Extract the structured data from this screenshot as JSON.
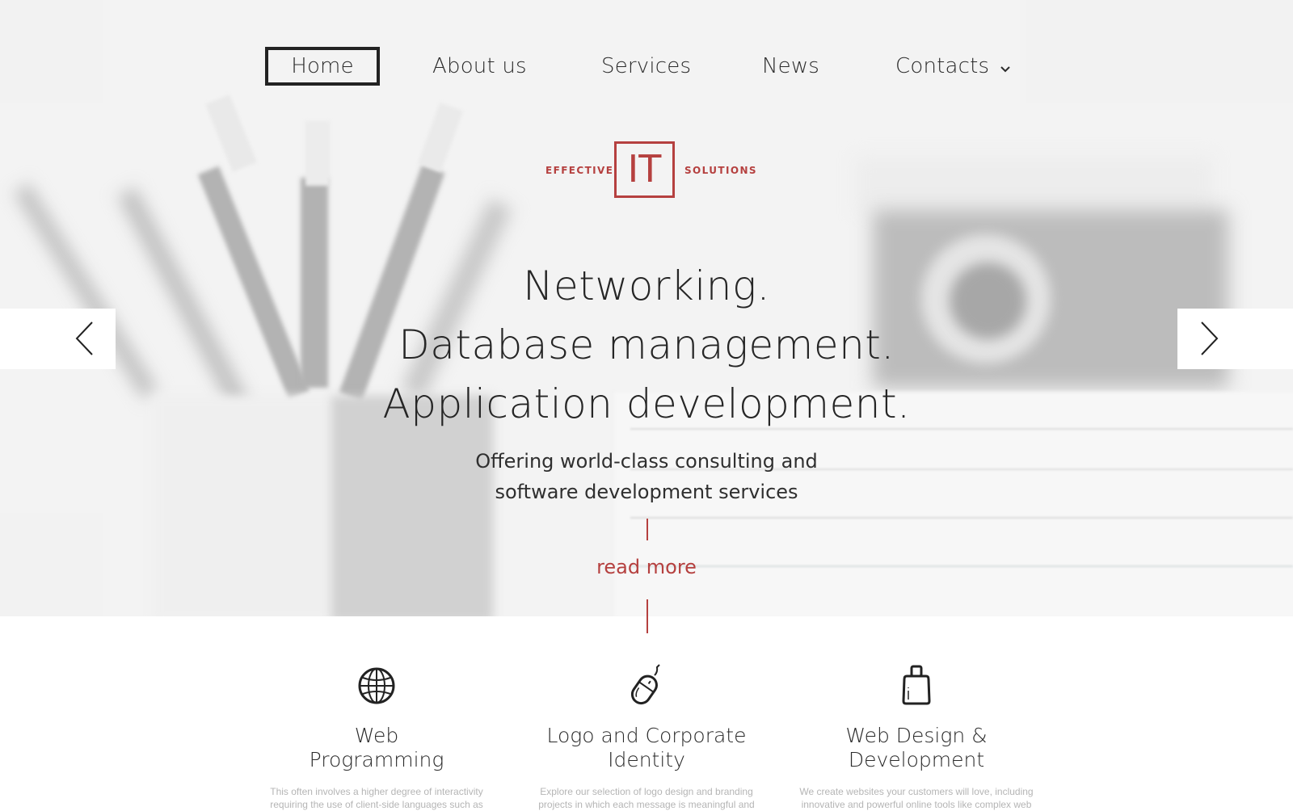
{
  "nav": {
    "items": [
      {
        "label": "Home",
        "active": true
      },
      {
        "label": "About us"
      },
      {
        "label": "Services"
      },
      {
        "label": "News"
      },
      {
        "label": "Contacts",
        "has_dropdown": true,
        "icon": "chevron-down-icon"
      }
    ]
  },
  "logo": {
    "left_text": "EFFECTIVE",
    "mark": "IT",
    "right_text": "SOLUTIONS"
  },
  "hero": {
    "headline_lines": [
      "Networking.",
      "Database management.",
      "Application development."
    ],
    "subtitle_lines": [
      "Offering world-class consulting and",
      "software development services"
    ],
    "cta_label": "read more",
    "prev_icon": "chevron-left-icon",
    "next_icon": "chevron-right-icon"
  },
  "services": [
    {
      "icon": "globe-icon",
      "title_lines": [
        "Web",
        "Programming"
      ],
      "description_lines": [
        "This often involves a higher degree of interactivity",
        "requiring the use of client-side languages such as"
      ]
    },
    {
      "icon": "mouse-icon",
      "title_lines": [
        "Logo and Corporate",
        "Identity"
      ],
      "description_lines": [
        "Explore our selection of logo design and branding",
        "projects in which each message is meaningful and"
      ]
    },
    {
      "icon": "shopping-bag-icon",
      "title_lines": [
        "Web Design &",
        "Development"
      ],
      "description_lines": [
        "We create websites your customers will love, including",
        "innovative and powerful online tools like complex web"
      ]
    }
  ],
  "colors": {
    "accent": "#b5403f",
    "text": "#2a2a2a",
    "muted_text": "#b5b5b5"
  }
}
